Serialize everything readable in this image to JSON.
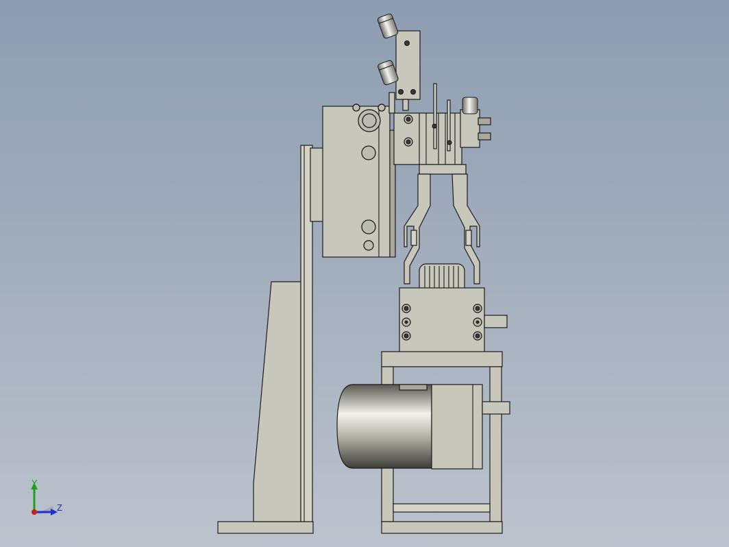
{
  "view": {
    "background_top": "#8d9db2",
    "background_bottom": "#bcc3cd",
    "part_fill": "#c8c7bb",
    "edge_color": "#1b1b1b"
  },
  "axis_triad": {
    "y_label": "Y",
    "z_label": "Z",
    "y_color": "#1ea01e",
    "z_color": "#1e2fd0",
    "x_color": "#c81e1e"
  }
}
